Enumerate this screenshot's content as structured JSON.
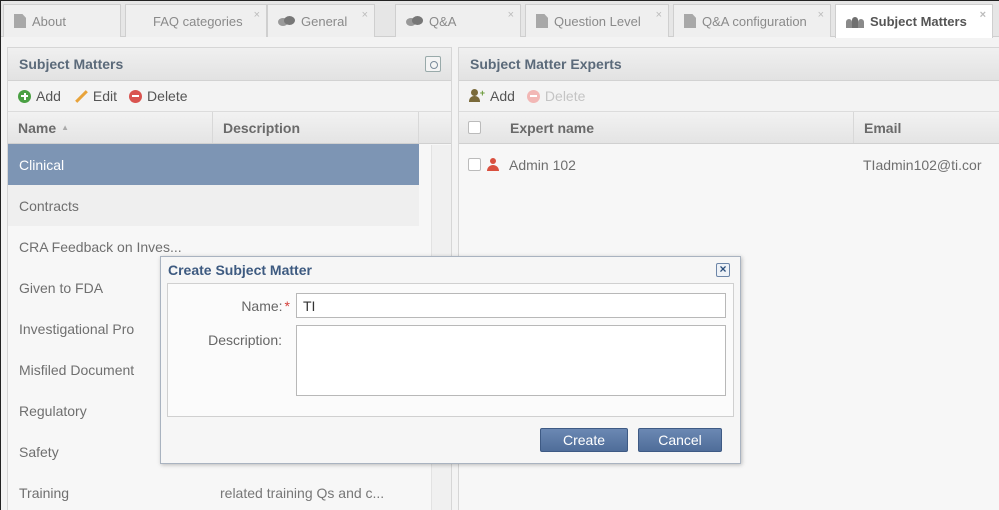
{
  "tabs": [
    {
      "label": "About",
      "icon": "document-icon",
      "closable": false,
      "active": false
    },
    {
      "label": "FAQ categories",
      "icon": "",
      "closable": true,
      "active": false
    },
    {
      "label": "General",
      "icon": "chat-bubbles-icon",
      "closable": true,
      "active": false
    },
    {
      "label": "Q&A",
      "icon": "chat-bubbles-icon",
      "closable": true,
      "active": false
    },
    {
      "label": "Question Level",
      "icon": "document-icon",
      "closable": true,
      "active": false
    },
    {
      "label": "Q&A configuration",
      "icon": "document-icon",
      "closable": true,
      "active": false
    },
    {
      "label": "Subject Matters",
      "icon": "people-icon",
      "closable": true,
      "active": true
    }
  ],
  "tab_close_glyph": "×",
  "left_panel": {
    "title": "Subject Matters",
    "toolbar": {
      "add": "Add",
      "edit": "Edit",
      "delete": "Delete"
    },
    "columns": {
      "name": "Name",
      "description": "Description"
    },
    "sort_indicator": "▲",
    "rows": [
      {
        "name": "Clinical",
        "description": "",
        "selected": true
      },
      {
        "name": "Contracts",
        "description": "",
        "selected": false
      },
      {
        "name": "CRA Feedback on Inves...",
        "description": "",
        "selected": false
      },
      {
        "name": "Given to FDA",
        "description": "",
        "selected": false
      },
      {
        "name": "Investigational Pro",
        "description": "",
        "selected": false
      },
      {
        "name": "Misfiled Document",
        "description": "",
        "selected": false
      },
      {
        "name": "Regulatory",
        "description": "",
        "selected": false
      },
      {
        "name": "Safety",
        "description": "",
        "selected": false
      },
      {
        "name": "Training",
        "description": "related training Qs and c...",
        "selected": false
      }
    ]
  },
  "right_panel": {
    "title": "Subject Matter Experts",
    "toolbar": {
      "add": "Add",
      "delete": "Delete"
    },
    "columns": {
      "expert_name": "Expert name",
      "email": "Email"
    },
    "rows": [
      {
        "expert_name": "Admin 102",
        "email": "TIadmin102@ti.cor"
      }
    ]
  },
  "dialog": {
    "title": "Create Subject Matter",
    "close_glyph": "×",
    "name_label": "Name:",
    "required_mark": "*",
    "name_value": "TI",
    "description_label": "Description:",
    "description_value": "",
    "create_label": "Create",
    "cancel_label": "Cancel"
  },
  "colors": {
    "selected_row": "#7d95b4",
    "dialog_title": "#3d5a80",
    "button": "#5877a3",
    "add_green": "#4aa043",
    "delete_red": "#d9534f"
  }
}
